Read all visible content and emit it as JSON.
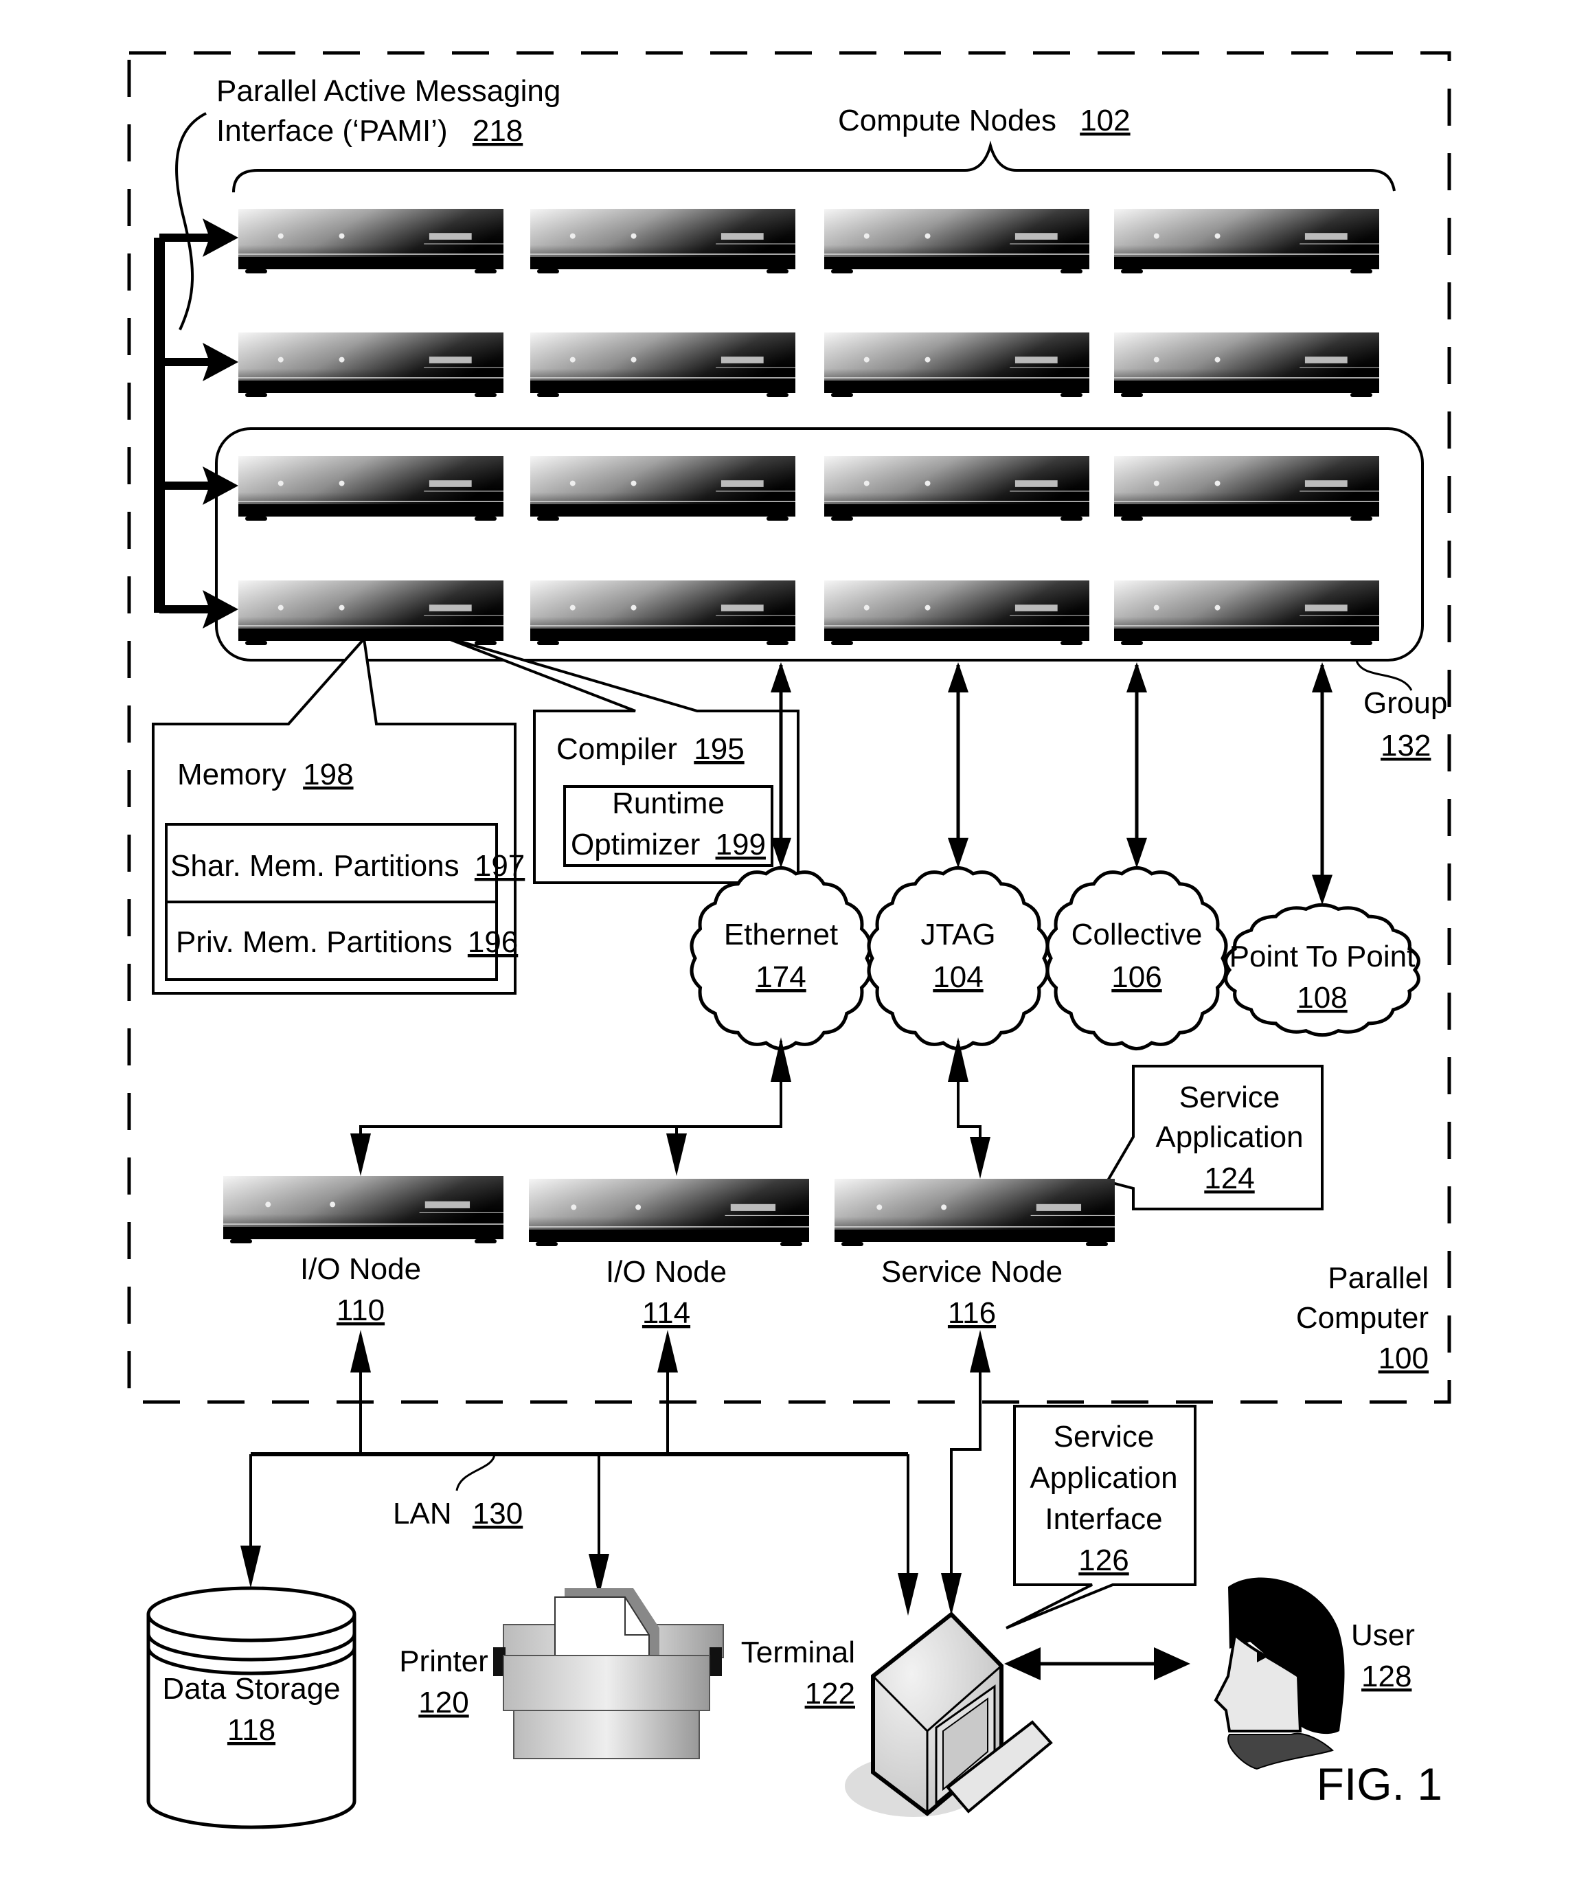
{
  "figure": {
    "title": "FIG. 1",
    "parallel_computer": {
      "label_lines": [
        "Parallel",
        "Computer"
      ],
      "ref": "100"
    },
    "pami": {
      "label_lines": [
        "Parallel Active Messaging",
        "Interface (‘PAMI’)"
      ],
      "ref": "218"
    },
    "compute_nodes": {
      "label": "Compute Nodes",
      "ref": "102",
      "rows": 4,
      "cols": 4
    },
    "group": {
      "label": "Group",
      "ref": "132"
    },
    "memory": {
      "label": "Memory",
      "ref": "198",
      "partitions": [
        {
          "label": "Shar. Mem. Partitions",
          "ref": "197"
        },
        {
          "label": "Priv. Mem. Partitions",
          "ref": "196"
        }
      ]
    },
    "compiler": {
      "label": "Compiler",
      "ref": "195",
      "optimizer": {
        "label_lines": [
          "Runtime",
          "Optimizer"
        ],
        "ref": "199"
      }
    },
    "networks": [
      {
        "label": "Ethernet",
        "ref": "174"
      },
      {
        "label": "JTAG",
        "ref": "104"
      },
      {
        "label": "Collective",
        "ref": "106"
      },
      {
        "label": "Point To Point",
        "ref": "108"
      }
    ],
    "service_application": {
      "label_lines": [
        "Service",
        "Application"
      ],
      "ref": "124"
    },
    "io_nodes": [
      {
        "label": "I/O Node",
        "ref": "110"
      },
      {
        "label": "I/O Node",
        "ref": "114"
      }
    ],
    "service_node": {
      "label": "Service Node",
      "ref": "116"
    },
    "lan": {
      "label": "LAN",
      "ref": "130"
    },
    "data_storage": {
      "label": "Data Storage",
      "ref": "118"
    },
    "printer": {
      "label": "Printer",
      "ref": "120"
    },
    "terminal": {
      "label": "Terminal",
      "ref": "122"
    },
    "service_app_interface": {
      "label_lines": [
        "Service",
        "Application",
        "Interface"
      ],
      "ref": "126"
    },
    "user": {
      "label": "User",
      "ref": "128"
    }
  }
}
